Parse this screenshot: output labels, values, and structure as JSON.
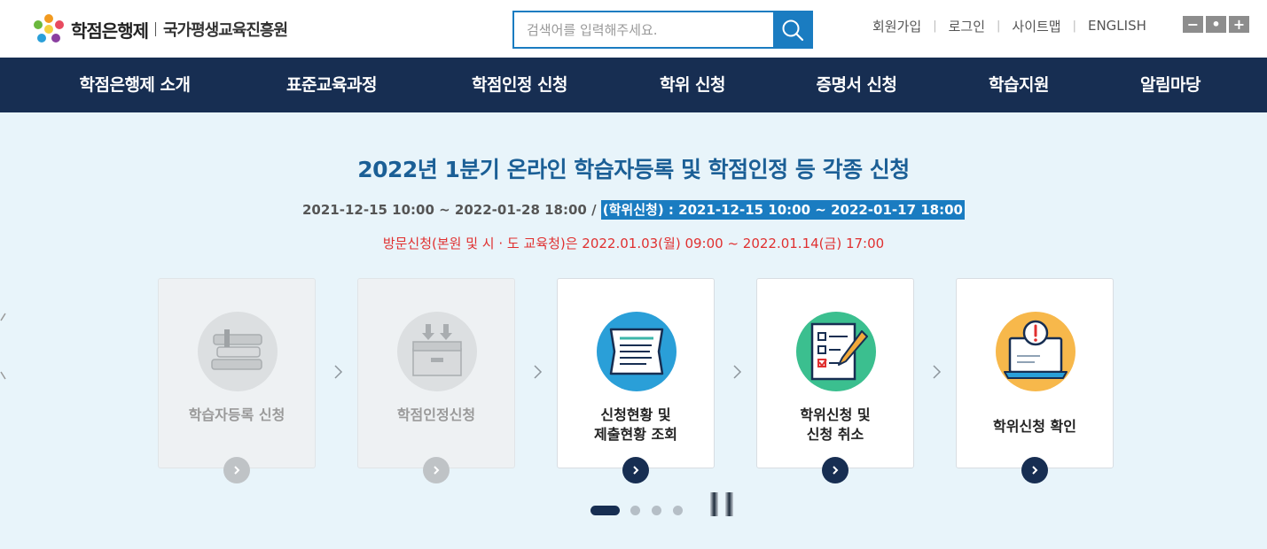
{
  "header": {
    "logo_name": "학점은행제",
    "logo_org": "국가평생교육진흥원",
    "search": {
      "placeholder": "검색어를 입력해주세요.",
      "value": ""
    },
    "util_links": [
      "회원가입",
      "로그인",
      "사이트맵",
      "ENGLISH"
    ],
    "font_size_buttons": [
      "−",
      "•",
      "+"
    ]
  },
  "gnb": {
    "items": [
      "학점은행제 소개",
      "표준교육과정",
      "학점인정 신청",
      "학위 신청",
      "증명서 신청",
      "학습지원",
      "알림마당"
    ]
  },
  "notice": {
    "title": "2022년 1분기 온라인 학습자등록 및 학점인정 등 각종 신청",
    "period_main": "2021-12-15 10:00 ~ 2022-01-28 18:00 /",
    "period_highlight": "(학위신청) : 2021-12-15 10:00 ~ 2022-01-17 18:00",
    "visit": "방문신청(본원 및 시 · 도 교육청)은 2022.01.03(월) 09:00 ~ 2022.01.14(금) 17:00"
  },
  "steps": [
    {
      "label": "학습자등록 신청",
      "icon": "books-icon",
      "state": "disabled"
    },
    {
      "label": "학점인정신청",
      "icon": "inbox-tray-icon",
      "state": "disabled"
    },
    {
      "label": "신청현황 및\n제출현황 조회",
      "icon": "document-list-icon",
      "state": "active"
    },
    {
      "label": "학위신청 및\n신청 취소",
      "icon": "checklist-pencil-icon",
      "state": "active"
    },
    {
      "label": "학위신청 확인",
      "icon": "laptop-alert-icon",
      "state": "active"
    }
  ],
  "carousel": {
    "page_count": 4,
    "current_page": 1
  },
  "colors": {
    "navy": "#172e52",
    "blue": "#1a7cc1",
    "title_blue": "#1b5f96",
    "red": "#e03030",
    "background": "#e8f4fa"
  }
}
